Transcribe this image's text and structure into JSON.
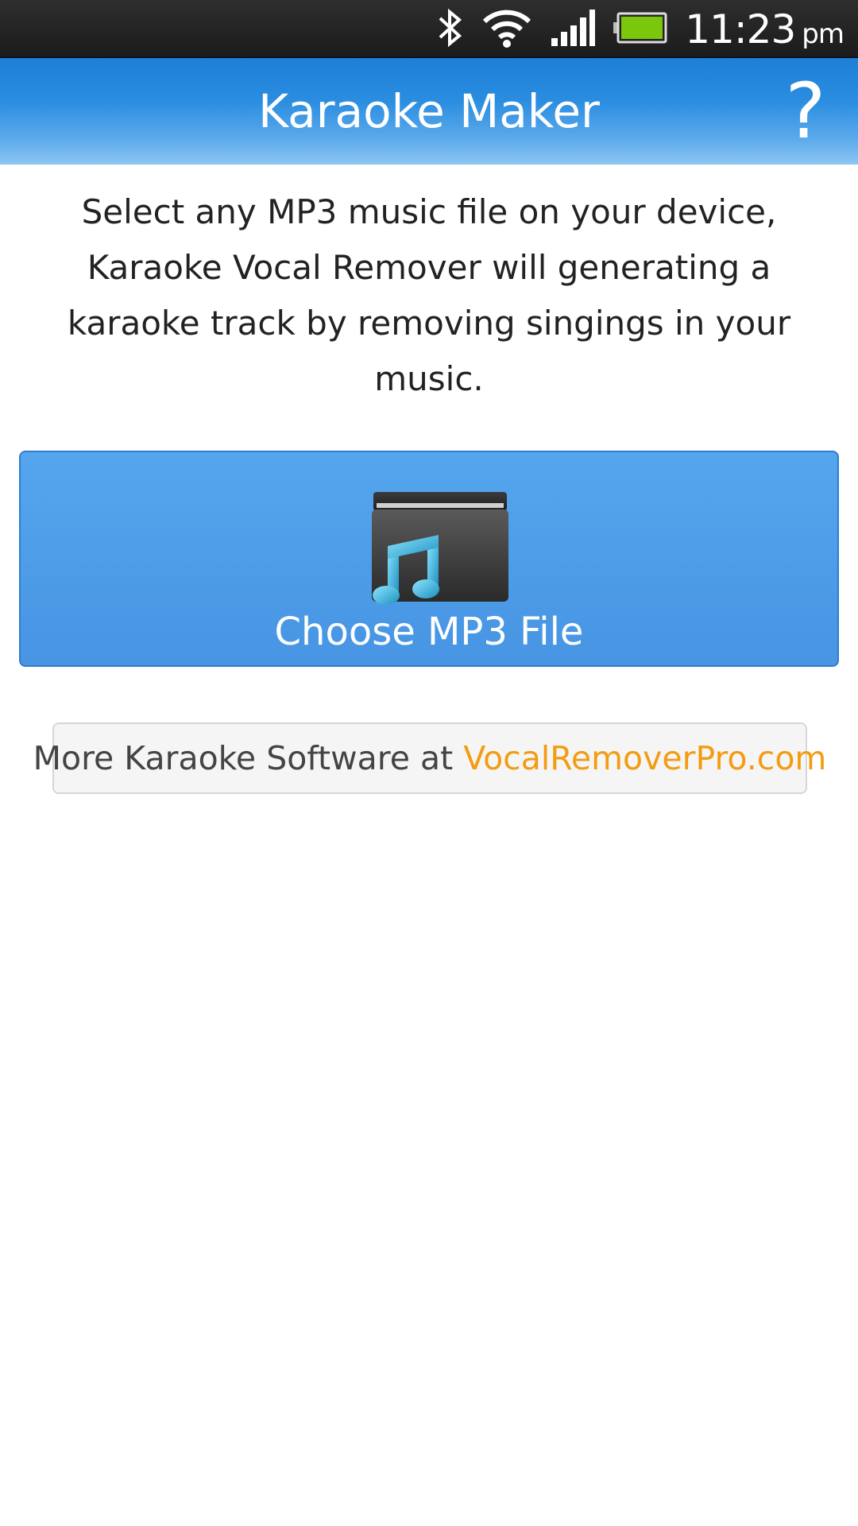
{
  "status_bar": {
    "time": "11:23",
    "ampm": "pm",
    "icons": [
      "bluetooth-icon",
      "wifi-icon",
      "signal-icon",
      "battery-icon"
    ],
    "battery_color": "#7ac70c"
  },
  "action_bar": {
    "title": "Karaoke Maker",
    "help_label": "?"
  },
  "main": {
    "description": "Select any MP3 music file on your device, Karaoke Vocal Remover will generating a karaoke track by removing singings in your music.",
    "choose_button_label": "Choose MP3 File",
    "choose_button_icon": "music-folder-icon",
    "more_link_prefix": "More Karaoke Software at ",
    "more_link_site": "VocalRemoverPro.com"
  },
  "colors": {
    "accent": "#4a9ae6",
    "link": "#f39c12"
  }
}
